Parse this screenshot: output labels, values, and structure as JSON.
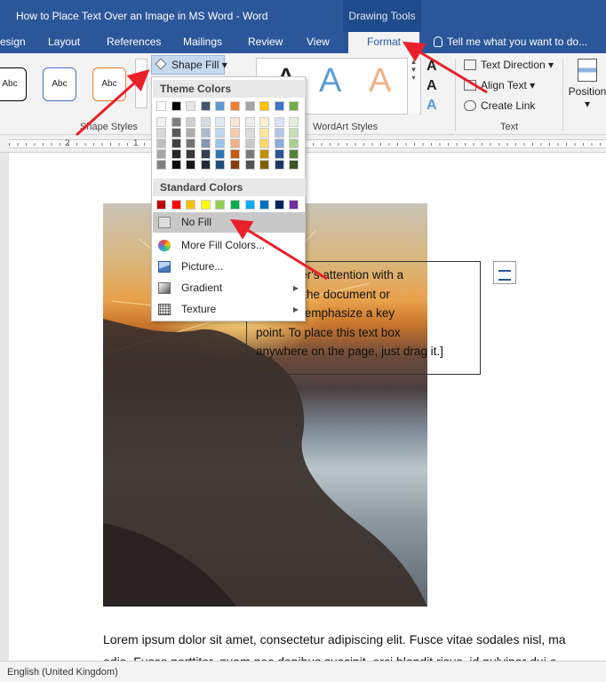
{
  "window": {
    "title": "How to Place Text Over an Image in MS Word - Word",
    "context_group": "Drawing Tools"
  },
  "tabs": [
    {
      "label": "esign"
    },
    {
      "label": "Layout"
    },
    {
      "label": "References"
    },
    {
      "label": "Mailings"
    },
    {
      "label": "Review"
    },
    {
      "label": "View"
    },
    {
      "label": "Format",
      "active": true
    }
  ],
  "tell_me": "Tell me what you want to do...",
  "ribbon": {
    "shape_styles": {
      "boxes": [
        "Abc",
        "Abc",
        "Abc"
      ],
      "group_label": "Shape Styles",
      "box_colors": [
        "#000000",
        "#4472c4",
        "#ed7d31"
      ]
    },
    "shape_fill_label": "Shape Fill",
    "wordart": {
      "group_label": "WordArt Styles",
      "glyphs": [
        "A",
        "A",
        "A"
      ],
      "colors": [
        "#222222",
        "#5b9bd5",
        "#f4b183"
      ],
      "side_glyphs": [
        "A",
        "A",
        "A"
      ]
    },
    "text_group": {
      "items": [
        "Text Direction",
        "Align Text",
        "Create Link"
      ],
      "group_label": "Text"
    },
    "position_label": "Position"
  },
  "ruler": {
    "numbers": [
      "2",
      "1"
    ]
  },
  "menu": {
    "theme_header": "Theme Colors",
    "theme_top_row": [
      "#ffffff",
      "#000000",
      "#e7e6e6",
      "#44546a",
      "#5b9bd5",
      "#ed7d31",
      "#a5a5a5",
      "#ffc000",
      "#4472c4",
      "#70ad47"
    ],
    "theme_columns": [
      [
        "#f2f2f2",
        "#d9d9d9",
        "#bfbfbf",
        "#a6a6a6",
        "#808080"
      ],
      [
        "#808080",
        "#595959",
        "#404040",
        "#262626",
        "#0d0d0d"
      ],
      [
        "#d0cece",
        "#aeabab",
        "#767171",
        "#3b3838",
        "#171616"
      ],
      [
        "#d6dce5",
        "#adb9ca",
        "#8497b0",
        "#333f50",
        "#222a35"
      ],
      [
        "#deebf7",
        "#bdd7ee",
        "#9dc3e6",
        "#2e75b6",
        "#1f4e79"
      ],
      [
        "#fbe5d6",
        "#f8cbad",
        "#f4b183",
        "#c55a11",
        "#843c0c"
      ],
      [
        "#ededed",
        "#dbdbdb",
        "#c9c9c9",
        "#7b7b7b",
        "#525252"
      ],
      [
        "#fff2cc",
        "#ffe699",
        "#ffd966",
        "#bf9000",
        "#7f6000"
      ],
      [
        "#dae3f3",
        "#b4c7e7",
        "#8faadc",
        "#2f5597",
        "#203864"
      ],
      [
        "#e2f0d9",
        "#c5e0b4",
        "#a9d18e",
        "#548235",
        "#385723"
      ]
    ],
    "standard_header": "Standard Colors",
    "standard_colors": [
      "#c00000",
      "#ff0000",
      "#ffc000",
      "#ffff00",
      "#92d050",
      "#00b050",
      "#00b0f0",
      "#0070c0",
      "#002060",
      "#7030a0"
    ],
    "items": [
      {
        "label": "No Fill",
        "icon": "no-fill-icon"
      },
      {
        "label": "More Fill Colors...",
        "icon": "palette-icon"
      },
      {
        "label": "Picture...",
        "icon": "picture-icon"
      },
      {
        "label": "Gradient",
        "icon": "gradient-icon",
        "submenu": true
      },
      {
        "label": "Texture",
        "icon": "texture-icon",
        "submenu": true
      }
    ]
  },
  "document": {
    "textbox_lines": [
      "our reader's attention with a",
      "ote from the document or",
      "space to emphasize a key",
      "point. To place this text box",
      "anywhere on the page, just drag it.]"
    ],
    "body_line_1": "Lorem ipsum dolor sit amet, consectetur adipiscing elit. Fusce vitae sodales nisl, ma",
    "body_line_2": "odio. Fusce porttitor, quam nec dapibus suscipit, orci blandit risus, id pulvinar dui e"
  },
  "status_bar": {
    "language": "English (United Kingdom)"
  },
  "annotation_color": "#e8202a"
}
